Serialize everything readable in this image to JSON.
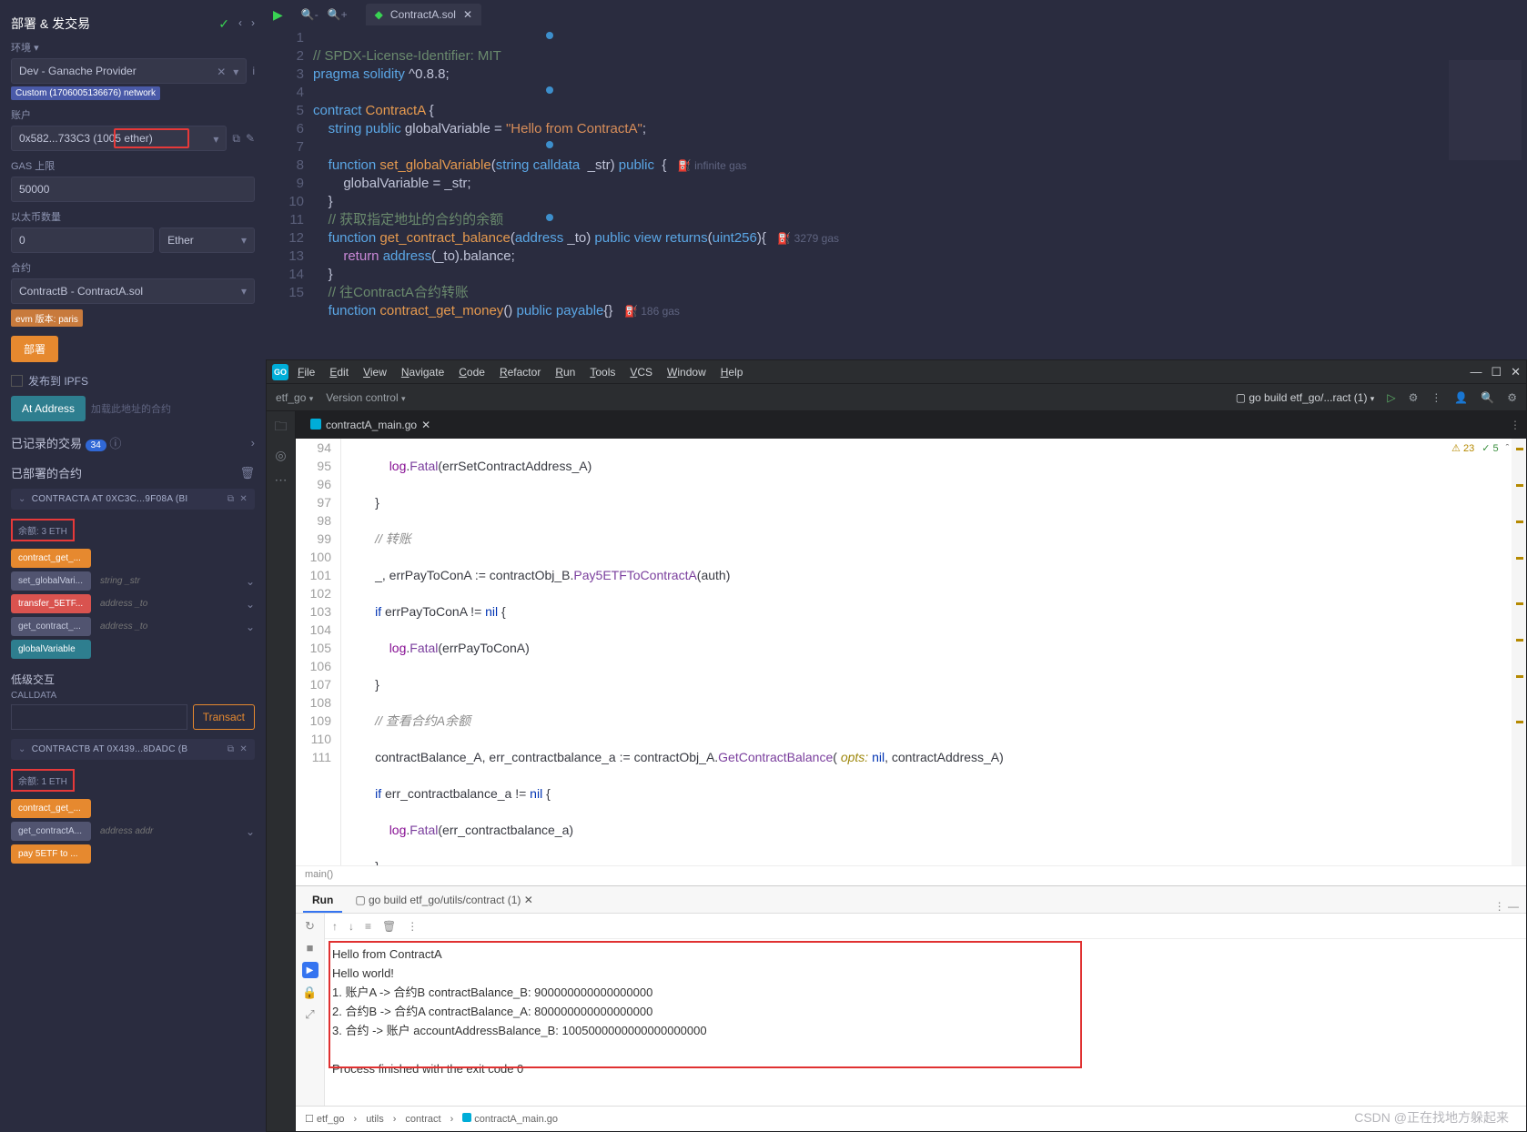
{
  "remix": {
    "deploy_title": "部署 & 发交易",
    "env_label": "环境",
    "env_value": "Dev - Ganache Provider",
    "network_badge": "Custom (1706005136676) network",
    "account_label": "账户",
    "account_value": "0x582...733C3 (1005 ether)",
    "gas_label": "GAS 上限",
    "gas_value": "50000",
    "value_label": "以太币数量",
    "value_amount": "0",
    "value_unit": "Ether",
    "contract_label": "合约",
    "contract_select": "ContractB - ContractA.sol",
    "evm_badge": "evm 版本: paris",
    "btn_deploy": "部署",
    "chk_ipfs": "发布到 IPFS",
    "btn_ataddress": "At Address",
    "ataddress_hint": "加载此地址的合约",
    "tx_header": "已记录的交易",
    "tx_count": "34",
    "deployed_header": "已部署的合约",
    "contractA_title": "CONTRACTA AT 0XC3C...9F08A (BI",
    "contractA_balance": "余额: 3 ETH",
    "fnA": [
      {
        "cls": "fn-orange",
        "label": "contract_get_..."
      },
      {
        "cls": "fn-grey",
        "label": "set_globalVari...",
        "ph": "string _str"
      },
      {
        "cls": "fn-red",
        "label": "transfer_5ETF...",
        "ph": "address _to"
      },
      {
        "cls": "fn-grey",
        "label": "get_contract_...",
        "ph": "address _to"
      },
      {
        "cls": "fn-blue",
        "label": "globalVariable"
      }
    ],
    "lowlevel": "低级交互",
    "calldata": "CALLDATA",
    "transact": "Transact",
    "contractB_title": "CONTRACTB AT 0X439...8DADC (B",
    "contractB_balance": "余额: 1 ETH",
    "fnB": [
      {
        "cls": "fn-orange",
        "label": "contract_get_..."
      },
      {
        "cls": "fn-grey",
        "label": "get_contractA...",
        "ph": "address addr"
      },
      {
        "cls": "fn-orange",
        "label": "pay 5ETF to ..."
      }
    ]
  },
  "editor": {
    "tab": "ContractA.sol",
    "lines": [
      "1",
      "2",
      "3",
      "4",
      "5",
      "6",
      "7",
      "8",
      "9",
      "10",
      "11",
      "12",
      "13",
      "14",
      "15"
    ],
    "gas1": "infinite gas",
    "gas2": "3279 gas",
    "gas3": "186 gas"
  },
  "ij": {
    "menu": [
      "File",
      "Edit",
      "View",
      "Navigate",
      "Code",
      "Refactor",
      "Run",
      "Tools",
      "VCS",
      "Window",
      "Help"
    ],
    "proj": "etf_go",
    "vc": "Version control",
    "run_cfg": "go build etf_go/...ract (1)",
    "tab_file": "contractA_main.go",
    "badges_warn": "23",
    "badges_ok": "5",
    "gutter": [
      "94",
      "95",
      "96",
      "97",
      "98",
      "99",
      "100",
      "101",
      "102",
      "103",
      "104",
      "105",
      "106",
      "107",
      "108",
      "109",
      "110",
      "111"
    ],
    "breadcrumb_fn": "main()",
    "run_tab_run": "Run",
    "run_tab_build": "go build etf_go/utils/contract (1)",
    "console": {
      "l1": "Hello from ContractA",
      "l2": "Hello world!",
      "l3": "1. 账户A -> 合约B contractBalance_B: 900000000000000000",
      "l4": "2. 合约B -> 合约A contractBalance_A: 800000000000000000",
      "l5": "3. 合约 -> 账户 accountAddressBalance_B: 1005000000000000000000",
      "exit": "Process finished with the exit code 0"
    },
    "statusbar": {
      "p1": "etf_go",
      "p2": "utils",
      "p3": "contract",
      "p4": "contractA_main.go"
    }
  },
  "watermark": "CSDN @正在找地方躲起来"
}
